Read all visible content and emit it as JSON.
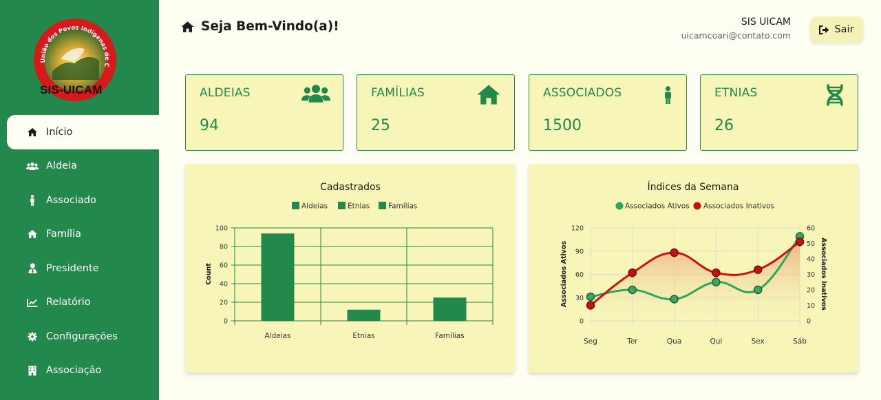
{
  "sidebar": {
    "logo_text": "SIS-UICAM",
    "logo_ring_text": "União dos Povos Indígenas de Coari - AM",
    "items": [
      {
        "label": "Início",
        "icon": "home-icon",
        "active": true
      },
      {
        "label": "Aldeia",
        "icon": "users-icon"
      },
      {
        "label": "Associado",
        "icon": "person-icon"
      },
      {
        "label": "Família",
        "icon": "home-icon"
      },
      {
        "label": "Presidente",
        "icon": "user-tie-icon"
      },
      {
        "label": "Relatório",
        "icon": "chart-line-icon"
      },
      {
        "label": "Configurações",
        "icon": "gear-icon"
      },
      {
        "label": "Associação",
        "icon": "building-icon"
      }
    ]
  },
  "header": {
    "welcome": "Seja Bem-Vindo(a)!",
    "user_name": "SIS UICAM",
    "user_email": "uicamcoari@contato.com",
    "logout_label": "Sair"
  },
  "stats": [
    {
      "label": "ALDEIAS",
      "value": "94",
      "icon": "users-icon"
    },
    {
      "label": "FAMÍLIAS",
      "value": "25",
      "icon": "home-icon"
    },
    {
      "label": "ASSOCIADOS",
      "value": "1500",
      "icon": "person-icon"
    },
    {
      "label": "ETNIAS",
      "value": "26",
      "icon": "dna-icon"
    }
  ],
  "colors": {
    "brand_green": "#22884b",
    "card_bg": "#f7f5b8",
    "page_bg": "#fffef2",
    "active_series": "#2aa85a",
    "inactive_series": "#cc1010"
  },
  "chart_data": [
    {
      "type": "bar",
      "title": "Cadastrados",
      "legend": [
        "Aldeias",
        "Etnias",
        "Famílias"
      ],
      "legend_placement": "top",
      "categories": [
        "Aldeias",
        "Etnias",
        "Famílias"
      ],
      "values": [
        94,
        12,
        25
      ],
      "xlabel": "",
      "ylabel": "Count",
      "ylim": [
        0,
        100
      ],
      "yticks": [
        0,
        20,
        40,
        60,
        80,
        100
      ],
      "grid": true
    },
    {
      "type": "line",
      "title": "Índices da Semana",
      "legend_placement": "top",
      "categories": [
        "Seg",
        "Ter",
        "Qua",
        "Qui",
        "Sex",
        "Sáb"
      ],
      "series": [
        {
          "name": "Associados Ativos",
          "axis": "left",
          "values": [
            31,
            40,
            28,
            50,
            40,
            109
          ]
        },
        {
          "name": "Associados Inativos",
          "axis": "right",
          "values": [
            10,
            31,
            44,
            31,
            33,
            51
          ]
        }
      ],
      "ylabel_left": "Associados Ativos",
      "ylabel_right": "Associados Inativos",
      "ylim_left": [
        0,
        120
      ],
      "yticks_left": [
        0,
        30,
        60,
        90,
        120
      ],
      "ylim_right": [
        0,
        60
      ],
      "yticks_right": [
        0,
        10,
        20,
        30,
        40,
        50,
        60
      ],
      "grid": true
    }
  ]
}
